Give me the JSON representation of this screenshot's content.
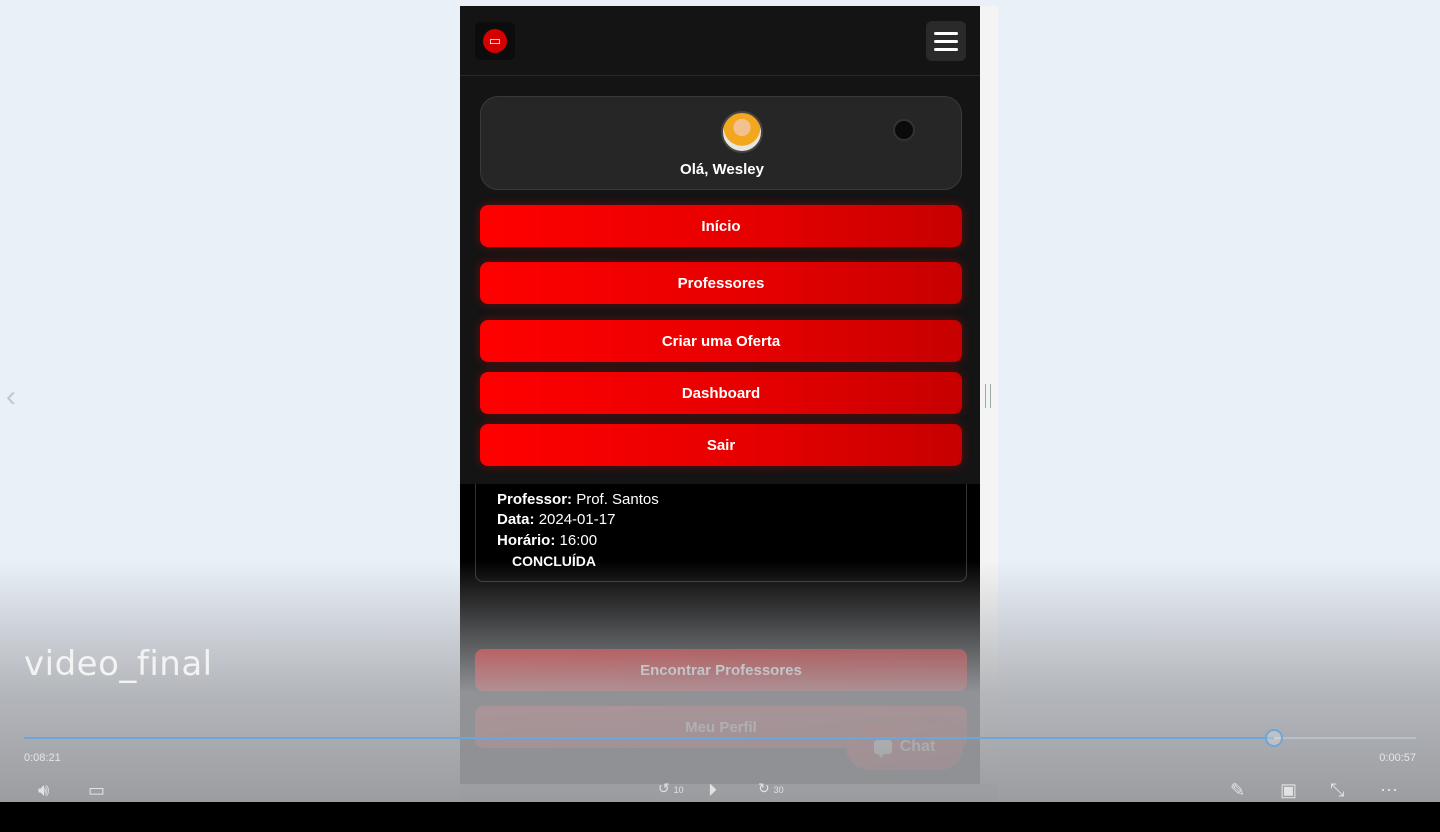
{
  "app": {
    "menu": {
      "greeting": "Olá, Wesley",
      "items": [
        "Início",
        "Professores",
        "Criar uma Oferta",
        "Dashboard",
        "Sair"
      ]
    },
    "lesson_card": {
      "professor_label": "Professor:",
      "professor_value": "Prof. Santos",
      "date_label": "Data:",
      "date_value": "2024-01-17",
      "time_label": "Horário:",
      "time_value": "16:00",
      "status": "CONCLUÍDA"
    },
    "actions": {
      "find_teachers": "Encontrar Professores",
      "my_profile": "Meu Perfil",
      "chat": "Chat"
    }
  },
  "player": {
    "title": "video_final",
    "elapsed": "0:08:21",
    "remaining": "0:00:57",
    "progress_fraction": 0.898,
    "skip_back": "10",
    "skip_forward": "30",
    "accent": "#6ea6d8"
  },
  "colors": {
    "brand_red": "#ff0000",
    "panel_bg": "#141414"
  }
}
